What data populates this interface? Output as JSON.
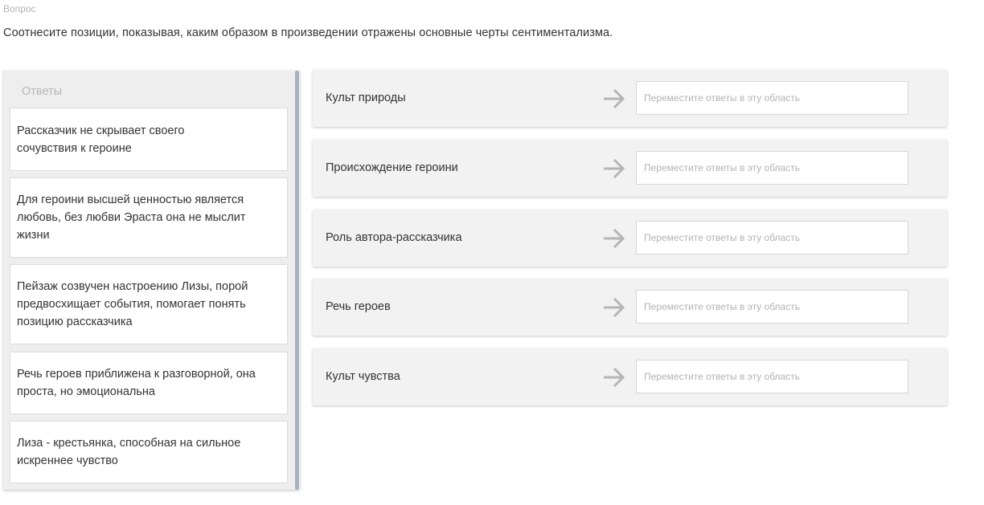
{
  "question": {
    "label": "Вопрос",
    "text": "Соотнесите позиции, показывая, каким образом в произведении отражены основные черты сентиментализма."
  },
  "answers": {
    "title": "Ответы",
    "items": [
      {
        "text": "Рассказчик не скрывает своего сочувствия к героине"
      },
      {
        "text": "Для героини высшей ценностью является любовь, без любви Эраста она не мыслит жизни"
      },
      {
        "text": "Пейзаж созвучен настроению Лизы, порой предвосхищает события, помогает понять позицию рассказчика"
      },
      {
        "text": "Речь героев приближена к разговорной, она проста, но эмоциональна"
      },
      {
        "text": "Лиза - крестьянка, способная на сильное искреннее чувство"
      }
    ]
  },
  "targets": [
    {
      "label": "Культ природы",
      "placeholder": "Переместите ответы в эту область"
    },
    {
      "label": "Происхождение героини",
      "placeholder": "Переместите ответы в эту область"
    },
    {
      "label": "Роль автора-рассказчика",
      "placeholder": "Переместите ответы в эту область"
    },
    {
      "label": "Речь героев",
      "placeholder": "Переместите ответы в эту область"
    },
    {
      "label": "Культ чувства",
      "placeholder": "Переместите ответы в эту область"
    }
  ],
  "icons": {
    "arrow": "arrow-right-icon"
  },
  "colors": {
    "panel": "#eeeeee",
    "target_row": "#f2f2f2",
    "scrollbar": "#a8b3c0",
    "arrow": "#b5b5b5"
  }
}
